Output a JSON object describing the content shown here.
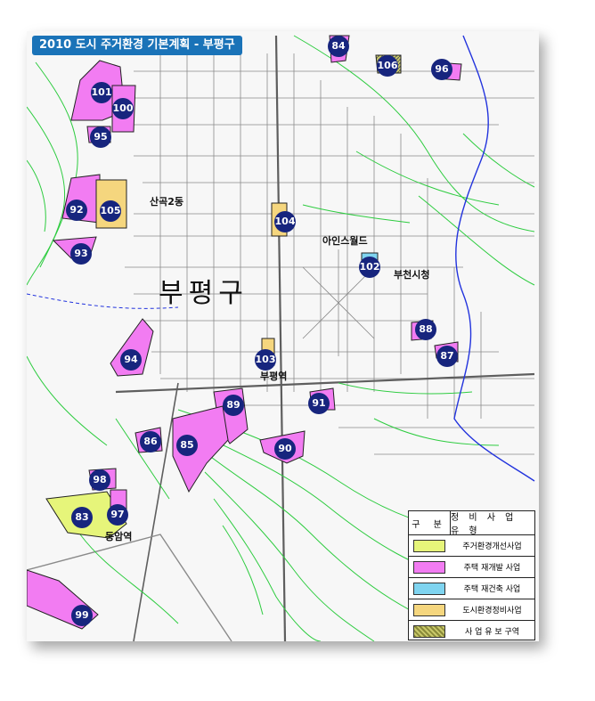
{
  "title": "2010 도시 주거환경 기본계획 - 부평구",
  "places": {
    "district": "부평구",
    "sangok2": "산곡2동",
    "ainsworld": "아인스월드",
    "bucheon_cityhall": "부천시청",
    "bupyeong_station": "부평역",
    "dongam_station": "동암역"
  },
  "markers": [
    "84",
    "106",
    "96",
    "101",
    "100",
    "95",
    "92",
    "105",
    "104",
    "93",
    "102",
    "88",
    "87",
    "94",
    "103",
    "91",
    "89",
    "86",
    "85",
    "90",
    "98",
    "83",
    "97",
    "99"
  ],
  "legend": {
    "header_left": "구 분",
    "header_right": "정 비 사 업 유 형",
    "items": [
      {
        "label": "주거환경개선사업",
        "color": "#e6f57a"
      },
      {
        "label": "주택 재개발 사업",
        "color": "#f27cf2"
      },
      {
        "label": "주택 재건축 사업",
        "color": "#7fd4f0"
      },
      {
        "label": "도시환경정비사업",
        "color": "#f5d67e"
      },
      {
        "label": "사 업 유 보 구역",
        "color": "#8a8a3a"
      }
    ]
  },
  "colors": {
    "title_bg": "#1a73b8",
    "marker_bg": "#17257e",
    "contour": "#2ecc40",
    "road": "#6e6e6e",
    "river": "#2233dd",
    "redevelopment": "#f27cf2",
    "improvement": "#e6f57a",
    "reconstruction": "#7fd4f0",
    "urban_env": "#f5d67e"
  }
}
